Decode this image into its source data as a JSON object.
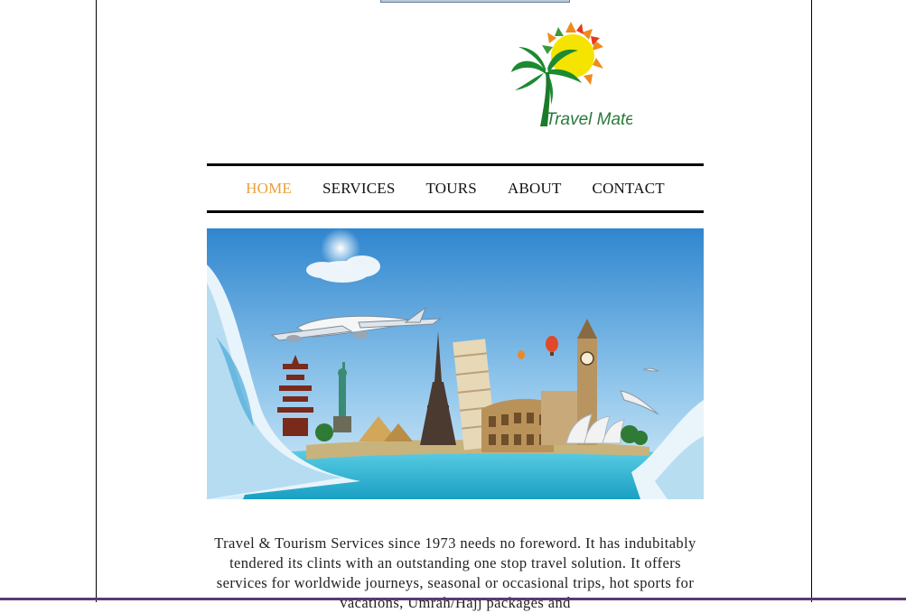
{
  "brand": {
    "name": "Travel Mate",
    "colors": {
      "sun": "#f5e000",
      "palm": "#1b8a2e",
      "text": "#2a7a3a",
      "accent": "#e9a13a"
    }
  },
  "nav": {
    "items": [
      {
        "label": "HOME",
        "active": true
      },
      {
        "label": "SERVICES",
        "active": false
      },
      {
        "label": "TOURS",
        "active": false
      },
      {
        "label": "ABOUT",
        "active": false
      },
      {
        "label": "CONTACT",
        "active": false
      }
    ]
  },
  "hero": {
    "icon": "travel-landmarks-banner"
  },
  "intro": {
    "text": "Travel & Tourism Services since 1973 needs no foreword. It has indubitably tendered its clints with an outstanding one stop travel solution. It offers services for worldwide journeys, seasonal or occasional trips, hot sports for vacations, Umrah/Hajj packages and"
  }
}
